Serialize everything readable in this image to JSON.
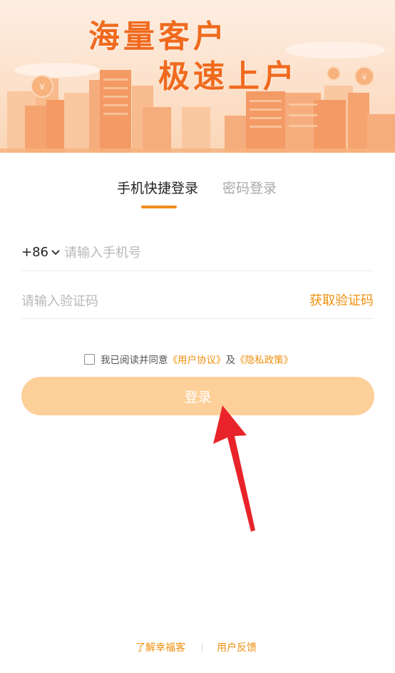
{
  "banner": {
    "line1": "海量客户",
    "line2": "极速上户",
    "colors": {
      "text": "#f06a1e",
      "sky_top": "#fde7d6",
      "sky_bottom": "#fbd2b0",
      "building_dark": "#f49a64",
      "building_light": "#f8b98a",
      "coin": "#f7b27e"
    },
    "icons": [
      "city-skyline-illustration",
      "coin-icon",
      "coin-icon",
      "coin-icon"
    ]
  },
  "tabs": [
    {
      "label": "手机快捷登录",
      "active": true
    },
    {
      "label": "密码登录",
      "active": false
    }
  ],
  "form": {
    "country_code": "+86",
    "phone_placeholder": "请输入手机号",
    "code_placeholder": "请输入验证码",
    "get_code_label": "获取验证码"
  },
  "agreement": {
    "text": "我已阅读并同意",
    "user_agreement": "《用户协议》",
    "conjunction": "及",
    "privacy_policy": "《隐私政策》",
    "checked": false
  },
  "login_button": {
    "label": "登录",
    "color": "#fdd09a"
  },
  "annotation": {
    "icon": "red-arrow-icon",
    "color": "#e8242a"
  },
  "footer": {
    "about": "了解幸福客",
    "feedback": "用户反馈"
  },
  "accent_color": "#f0900f"
}
